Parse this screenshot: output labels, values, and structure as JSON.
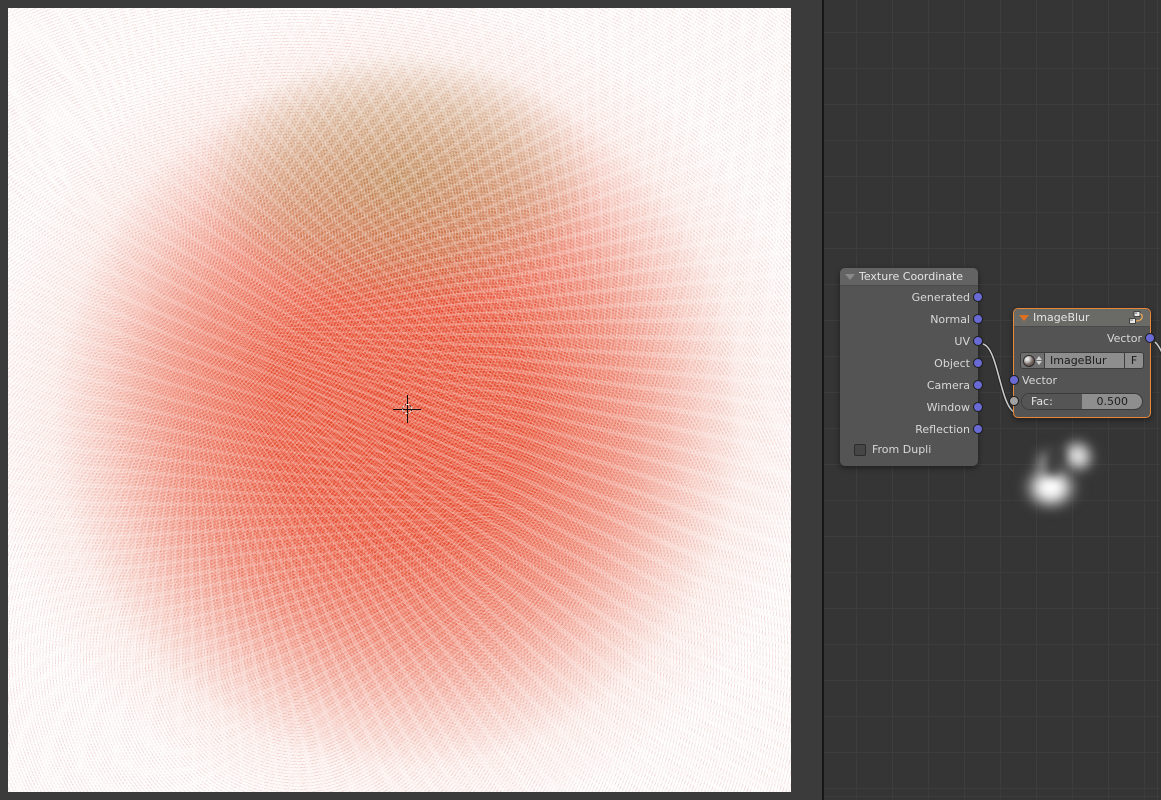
{
  "app": {
    "theme_bg": "#353535",
    "node_bg": "#545454",
    "accent_selected": "#e8893a",
    "socket_vector_color": "#6a6ad4",
    "socket_value_color": "#a1a1a1"
  },
  "image_editor": {
    "name": "image-preview",
    "cursor": "2d-cursor-crosshair",
    "content_description": "noisy red-orange radial gradient render"
  },
  "node_editor": {
    "backdrop": "blurred-white-flame",
    "grid": "on",
    "nodes": [
      {
        "id": "texture-coordinate",
        "title": "Texture Coordinate",
        "collapse_icon": "triangle-down-icon",
        "selected": false,
        "outputs": [
          {
            "label": "Generated",
            "type": "vector"
          },
          {
            "label": "Normal",
            "type": "vector"
          },
          {
            "label": "UV",
            "type": "vector"
          },
          {
            "label": "Object",
            "type": "vector"
          },
          {
            "label": "Camera",
            "type": "vector"
          },
          {
            "label": "Window",
            "type": "vector"
          },
          {
            "label": "Reflection",
            "type": "vector"
          }
        ],
        "checkbox": {
          "label": "From Dupli",
          "checked": false
        }
      },
      {
        "id": "image-blur",
        "title": "ImageBlur",
        "collapse_icon": "triangle-down-icon",
        "group_icon": "node-group-icon",
        "selected": true,
        "outputs": [
          {
            "label": "Vector",
            "type": "vector"
          }
        ],
        "datablock": {
          "browse_icon": "node-tree-sphere-icon",
          "spinner_icon": "up-down-arrows-icon",
          "name": "ImageBlur",
          "fake_user_label": "F"
        },
        "inputs": [
          {
            "label": "Vector",
            "type": "vector"
          }
        ],
        "slider": {
          "label": "Fac:",
          "value": "0.500",
          "fill_percent": 50,
          "type": "value"
        }
      }
    ],
    "links": [
      {
        "from": "texture-coordinate.UV",
        "to": "image-blur.Vector"
      },
      {
        "from": "image-blur.Vector",
        "to": "offscreen"
      }
    ]
  }
}
